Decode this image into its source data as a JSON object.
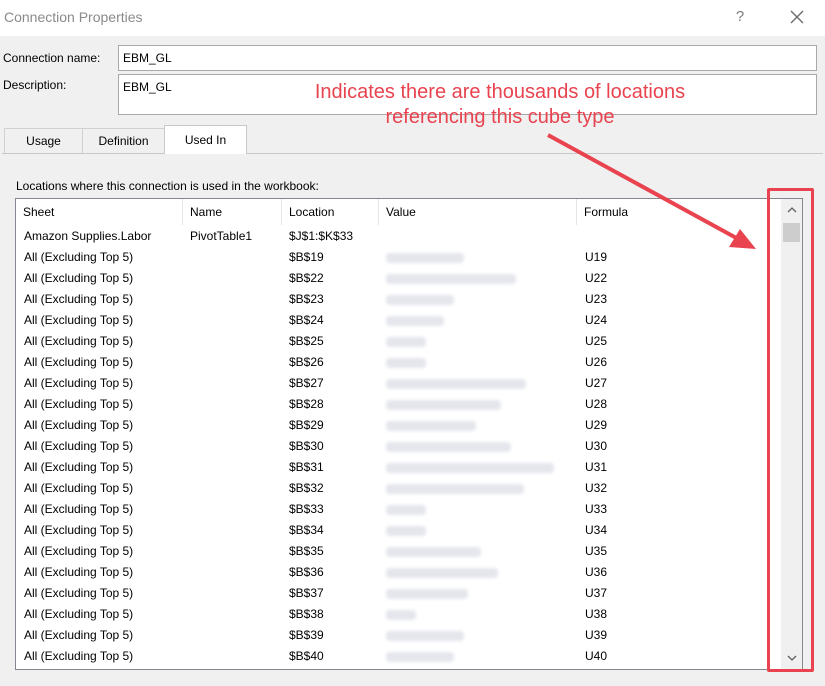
{
  "window": {
    "title": "Connection Properties",
    "help_label": "?"
  },
  "form": {
    "name_label": "Connection name:",
    "name_value": "EBM_GL",
    "desc_label": "Description:",
    "desc_value": "EBM_GL"
  },
  "tabs": [
    {
      "label": "Usage"
    },
    {
      "label": "Definition"
    },
    {
      "label": "Used In"
    }
  ],
  "active_tab": "Used In",
  "locations": {
    "caption": "Locations where this connection is used in the workbook:",
    "columns": [
      "Sheet",
      "Name",
      "Location",
      "Value",
      "Formula"
    ],
    "rows": [
      {
        "sheet": "Amazon Supplies.Labor",
        "name": "PivotTable1",
        "location": "$J$1:$K$33",
        "value": "",
        "formula": ""
      },
      {
        "sheet": "All (Excluding Top 5)",
        "name": "",
        "location": "$B$19",
        "value": "(redacted)",
        "formula": "U19"
      },
      {
        "sheet": "All (Excluding Top 5)",
        "name": "",
        "location": "$B$22",
        "value": "(redacted)",
        "formula": "U22"
      },
      {
        "sheet": "All (Excluding Top 5)",
        "name": "",
        "location": "$B$23",
        "value": "(redacted)",
        "formula": "U23"
      },
      {
        "sheet": "All (Excluding Top 5)",
        "name": "",
        "location": "$B$24",
        "value": "(redacted)",
        "formula": "U24"
      },
      {
        "sheet": "All (Excluding Top 5)",
        "name": "",
        "location": "$B$25",
        "value": "(redacted)",
        "formula": "U25"
      },
      {
        "sheet": "All (Excluding Top 5)",
        "name": "",
        "location": "$B$26",
        "value": "(redacted)",
        "formula": "U26"
      },
      {
        "sheet": "All (Excluding Top 5)",
        "name": "",
        "location": "$B$27",
        "value": "(redacted)",
        "formula": "U27"
      },
      {
        "sheet": "All (Excluding Top 5)",
        "name": "",
        "location": "$B$28",
        "value": "(redacted)",
        "formula": "U28"
      },
      {
        "sheet": "All (Excluding Top 5)",
        "name": "",
        "location": "$B$29",
        "value": "(redacted)",
        "formula": "U29"
      },
      {
        "sheet": "All (Excluding Top 5)",
        "name": "",
        "location": "$B$30",
        "value": "(redacted)",
        "formula": "U30"
      },
      {
        "sheet": "All (Excluding Top 5)",
        "name": "",
        "location": "$B$31",
        "value": "(redacted)",
        "formula": "U31"
      },
      {
        "sheet": "All (Excluding Top 5)",
        "name": "",
        "location": "$B$32",
        "value": "(redacted)",
        "formula": "U32"
      },
      {
        "sheet": "All (Excluding Top 5)",
        "name": "",
        "location": "$B$33",
        "value": "(redacted)",
        "formula": "U33"
      },
      {
        "sheet": "All (Excluding Top 5)",
        "name": "",
        "location": "$B$34",
        "value": "(redacted)",
        "formula": "U34"
      },
      {
        "sheet": "All (Excluding Top 5)",
        "name": "",
        "location": "$B$35",
        "value": "(redacted)",
        "formula": "U35"
      },
      {
        "sheet": "All (Excluding Top 5)",
        "name": "",
        "location": "$B$36",
        "value": "(redacted)",
        "formula": "U36"
      },
      {
        "sheet": "All (Excluding Top 5)",
        "name": "",
        "location": "$B$37",
        "value": "(redacted)",
        "formula": "U37"
      },
      {
        "sheet": "All (Excluding Top 5)",
        "name": "",
        "location": "$B$38",
        "value": "(redacted)",
        "formula": "U38"
      },
      {
        "sheet": "All (Excluding Top 5)",
        "name": "",
        "location": "$B$39",
        "value": "(redacted)",
        "formula": "U39"
      },
      {
        "sheet": "All (Excluding Top 5)",
        "name": "",
        "location": "$B$40",
        "value": "(redacted)",
        "formula": "U40"
      }
    ]
  },
  "annotation": {
    "line1": "Indicates there are thousands of locations",
    "line2": "referencing this cube type",
    "color": "#e8434f"
  },
  "icons": {
    "close": "close-icon",
    "scroll_up": "chevron-up-icon",
    "scroll_down": "chevron-down-icon"
  }
}
